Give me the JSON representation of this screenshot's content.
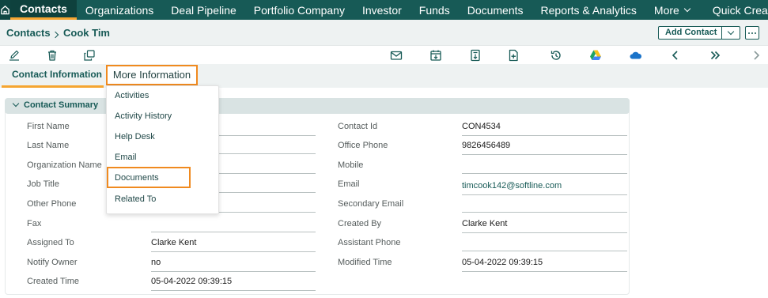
{
  "nav": {
    "items": [
      "Contacts",
      "Organizations",
      "Deal Pipeline",
      "Portfolio Company",
      "Investor",
      "Funds",
      "Documents",
      "Reports & Analytics",
      "More",
      "Quick Create"
    ]
  },
  "breadcrumb": {
    "section": "Contacts",
    "record": "Cook Tim"
  },
  "add_contact": "Add Contact",
  "tabs": {
    "contact_information": "Contact Information",
    "more_information": "More Information"
  },
  "dropdown": {
    "items": [
      "Activities",
      "Activity History",
      "Help Desk",
      "Email",
      "Documents",
      "Related To"
    ]
  },
  "summary": {
    "title": "Contact Summary",
    "left": [
      {
        "label": "First Name",
        "value": ""
      },
      {
        "label": "Last Name",
        "value": ""
      },
      {
        "label": "Organization Name",
        "value": ""
      },
      {
        "label": "Job Title",
        "value": ""
      },
      {
        "label": "Other Phone",
        "value": ""
      },
      {
        "label": "Fax",
        "value": ""
      },
      {
        "label": "Assigned To",
        "value": "Clarke Kent"
      },
      {
        "label": "Notify Owner",
        "value": "no"
      },
      {
        "label": "Created Time",
        "value": "05-04-2022 09:39:15"
      }
    ],
    "right": [
      {
        "label": "Contact Id",
        "value": "CON4534"
      },
      {
        "label": "Office Phone",
        "value": "9826456489"
      },
      {
        "label": "Mobile",
        "value": ""
      },
      {
        "label": "Email",
        "value": "timcook142@softline.com"
      },
      {
        "label": "Secondary Email",
        "value": ""
      },
      {
        "label": "Created By",
        "value": "Clarke Kent"
      },
      {
        "label": "Assistant Phone",
        "value": ""
      },
      {
        "label": "Modified Time",
        "value": "05-04-2022 09:39:15"
      }
    ]
  },
  "icons": [
    "home-icon",
    "edit-icon",
    "trash-icon",
    "duplicate-icon",
    "mail-icon",
    "calendar-icon",
    "archive-icon",
    "add-document-icon",
    "history-icon",
    "google-drive-icon",
    "onedrive-icon",
    "chevron-left-icon",
    "double-chevron-right-icon",
    "chevron-right-icon"
  ],
  "colors": {
    "brand": "#175a56",
    "accent": "#f5a531",
    "highlight": "#f08a1f"
  }
}
